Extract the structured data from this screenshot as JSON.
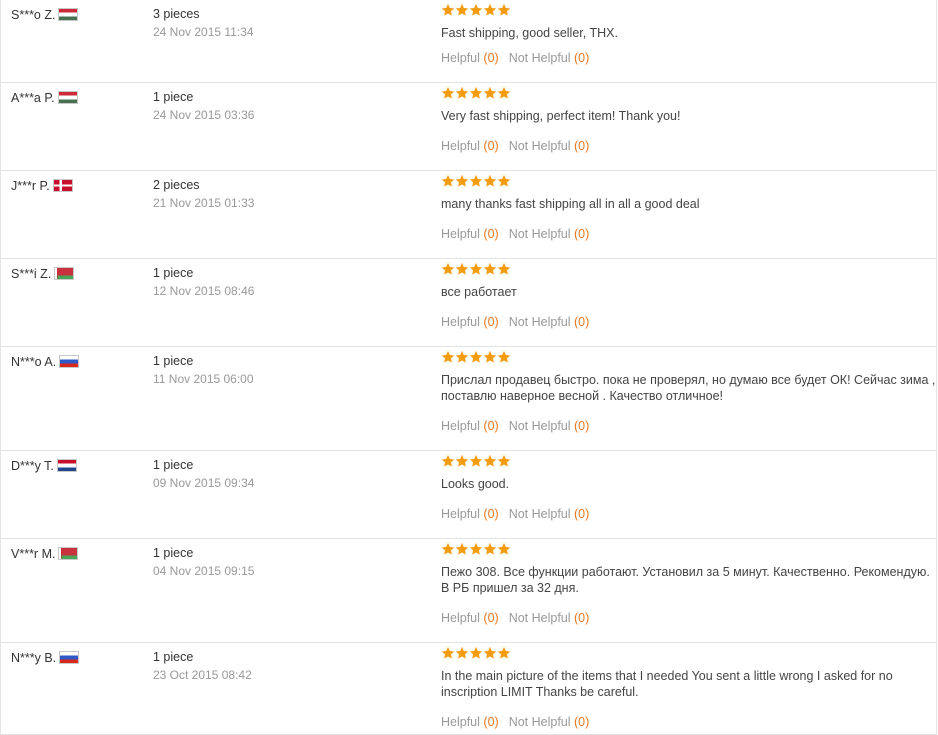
{
  "colors": {
    "star": "#f39c12",
    "vote_count": "#e8771f",
    "muted": "#999999",
    "divider": "#e1e1e1"
  },
  "labels": {
    "helpful": "Helpful",
    "not_helpful": "Not Helpful"
  },
  "feedback": [
    {
      "buyer": "S***o Z.",
      "country_flag": "hungary-flag",
      "quantity": "3 pieces",
      "date": "24 Nov 2015 11:34",
      "rating": 5,
      "text": "Fast shipping, good seller, THX.",
      "helpful_count": "(0)",
      "not_helpful_count": "(0)"
    },
    {
      "buyer": "A***a P.",
      "country_flag": "hungary-flag",
      "quantity": "1 piece",
      "date": "24 Nov 2015 03:36",
      "rating": 5,
      "text": "Very fast shipping, perfect item! Thank you!",
      "helpful_count": "(0)",
      "not_helpful_count": "(0)"
    },
    {
      "buyer": "J***r P.",
      "country_flag": "denmark-flag",
      "quantity": "2 pieces",
      "date": "21 Nov 2015 01:33",
      "rating": 5,
      "text": "many thanks fast shipping all in all a good deal",
      "helpful_count": "(0)",
      "not_helpful_count": "(0)"
    },
    {
      "buyer": "S***i Z.",
      "country_flag": "belarus-flag",
      "quantity": "1 piece",
      "date": "12 Nov 2015 08:46",
      "rating": 5,
      "text": "все работает",
      "helpful_count": "(0)",
      "not_helpful_count": "(0)"
    },
    {
      "buyer": "N***o A.",
      "country_flag": "russia-flag",
      "quantity": "1 piece",
      "date": "11 Nov 2015 06:00",
      "rating": 5,
      "text": "Прислал продавец быстро. пока не проверял, но думаю все будет ОК! Сейчас зима , поставлю наверное весной . Качество отличное!",
      "helpful_count": "(0)",
      "not_helpful_count": "(0)"
    },
    {
      "buyer": "D***y T.",
      "country_flag": "netherlands-flag",
      "quantity": "1 piece",
      "date": "09 Nov 2015 09:34",
      "rating": 5,
      "text": "Looks good.",
      "helpful_count": "(0)",
      "not_helpful_count": "(0)"
    },
    {
      "buyer": "V***r M.",
      "country_flag": "belarus-flag",
      "quantity": "1 piece",
      "date": "04 Nov 2015 09:15",
      "rating": 5,
      "text": "Пежо 308. Все функции работают. Установил за 5 минут. Качественно. Рекомендую. В РБ пришел за 32 дня.",
      "helpful_count": "(0)",
      "not_helpful_count": "(0)"
    },
    {
      "buyer": "N***y B.",
      "country_flag": "russia-flag",
      "quantity": "1 piece",
      "date": "23 Oct 2015 08:42",
      "rating": 5,
      "text": "In the main picture of the items that I needed You sent a little wrong I asked for no inscription LIMIT Thanks be careful.",
      "helpful_count": "(0)",
      "not_helpful_count": "(0)"
    }
  ]
}
